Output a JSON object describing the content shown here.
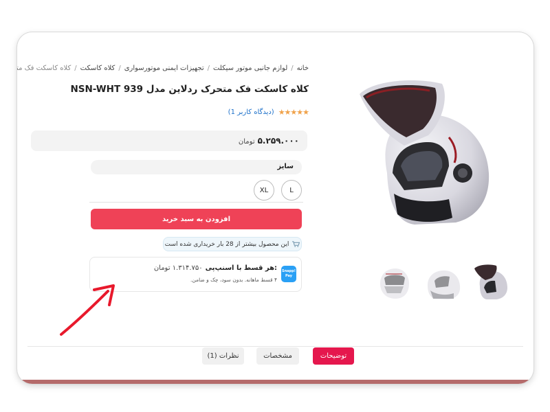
{
  "breadcrumb": {
    "items": [
      "خانه",
      "لوازم جانبی موتور سیکلت",
      "تجهیزات ایمنی موتورسواری",
      "کلاه کاسکت"
    ],
    "current": "کلاه کاسکت فک متحرک ردل",
    "separator": "/"
  },
  "product": {
    "title": "کلاه کاسکت فک متحرک ردلاین مدل NSN-WHT 939",
    "stars": "★★★★★",
    "reviews_link": "(دیدگاه کاربر 1)",
    "price_value": "۵.۲۵۹.۰۰۰",
    "price_unit": "تومان"
  },
  "options": {
    "size_label": "سایز",
    "sizes": [
      "L",
      "XL"
    ]
  },
  "actions": {
    "add_to_cart": "افزودن به سبد خرید"
  },
  "notice": {
    "popular_text": "این محصول بیشتر از 28 بار خریداری شده است"
  },
  "installment": {
    "logo_text": "Snapp! Pay",
    "title": "هر قسط با اسنپ‌پی:",
    "amount": "۱.۳۱۴.۷۵۰ تومان",
    "subtitle": "۴ قسط ماهانه. بدون سود، چک و ضامن."
  },
  "tabs": [
    "توضیحات",
    "مشخصات",
    "نظرات (1)"
  ],
  "colors": {
    "accent_red": "#ef4257",
    "tab_active": "#e5174d",
    "star": "#f0a24a",
    "link_blue": "#1b6fc9",
    "annotation_arrow": "#e8192c",
    "snapp_blue": "#2aa0f5"
  },
  "icons": {
    "cart": "cart-icon",
    "annotation": "arrow-icon"
  }
}
